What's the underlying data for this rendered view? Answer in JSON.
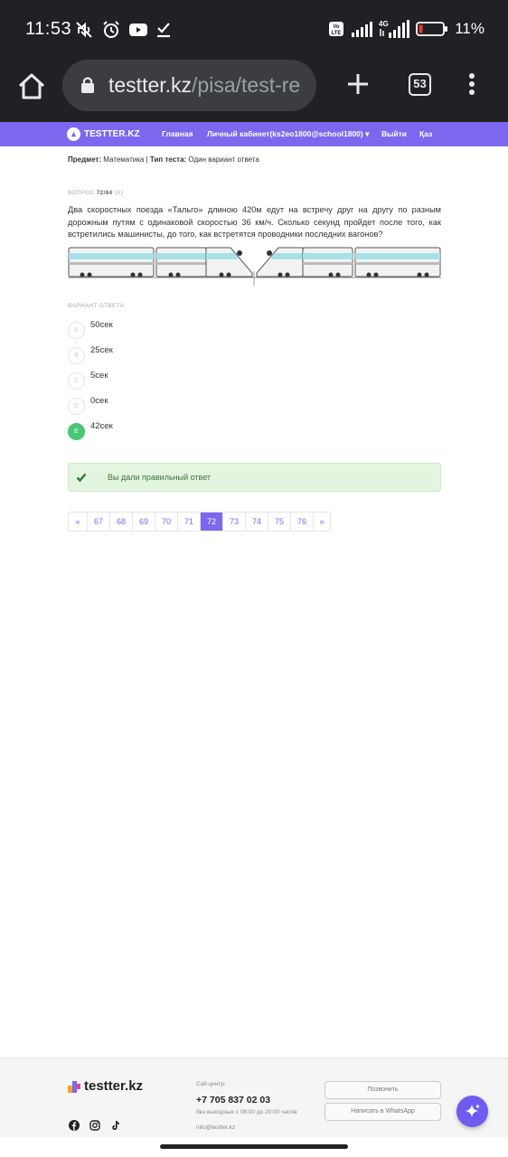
{
  "status_bar": {
    "time": "11:53",
    "network": "4G",
    "battery": "11%",
    "volte": "Vo LTE"
  },
  "browser": {
    "url_domain": "testter.kz",
    "url_path": "/pisa/test-re",
    "tab_count": "53"
  },
  "navbar": {
    "logo": "TESTTER.KZ",
    "items": [
      "Главная",
      "Личный кабинет(ks2eo1800@school1800)",
      "Выйти",
      "Қаз"
    ]
  },
  "meta": {
    "subject_label": "Предмет:",
    "subject": "Математика",
    "separator": "|",
    "test_type_label": "Тип теста:",
    "test_type": "Один вариант ответа"
  },
  "question": {
    "label": "ВОПРОС",
    "number": "72/84",
    "variant": "(A)",
    "text": "Два скоростных поезда «Тальго» длиною 420м едут на встречу друг на другу по разным дорожным путям с одинаковой скоростью 36 км/ч. Сколько секунд пройдет после того, как встретились машинисты, до того, как встретятся проводники последних вагонов?"
  },
  "answers": {
    "label": "ВАРИАНТ ОТВЕТА",
    "options": [
      {
        "letter": "A",
        "text": "50сек",
        "correct": false
      },
      {
        "letter": "B",
        "text": "25сек",
        "correct": false
      },
      {
        "letter": "C",
        "text": "5сек",
        "correct": false
      },
      {
        "letter": "D",
        "text": "0сек",
        "correct": false
      },
      {
        "letter": "E",
        "text": "42сек",
        "correct": true
      }
    ]
  },
  "result": {
    "message": "Вы дали правильный ответ"
  },
  "pagination": {
    "prev": "«",
    "pages": [
      "67",
      "68",
      "69",
      "70",
      "71",
      "72",
      "73",
      "74",
      "75",
      "76"
    ],
    "current": "72",
    "next": "»"
  },
  "footer": {
    "logo": "testter.kz",
    "call_label": "Call-центр:",
    "phone": "+7 705 837 02 03",
    "hours": "без выходных с 08:00 до 20:00 часов",
    "email": "info@testter.kz",
    "call_button": "Позвонить",
    "whatsapp_button": "Написать в WhatsApp"
  },
  "colors": {
    "brand": "#7b68ee",
    "success": "#48c774",
    "browser_bg": "#202124"
  }
}
